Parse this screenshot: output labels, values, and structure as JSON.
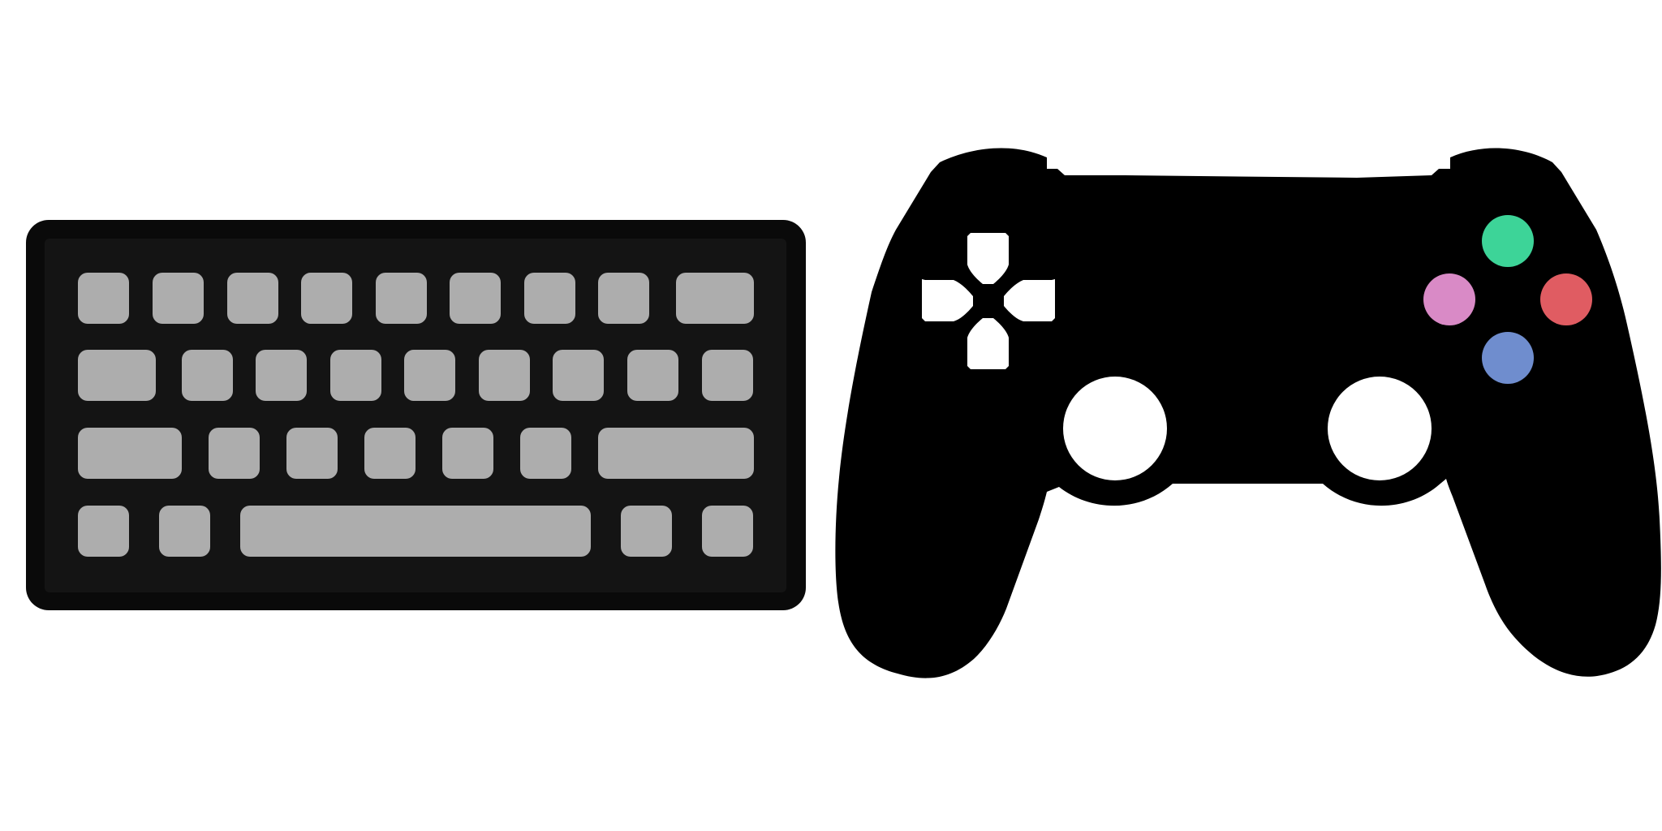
{
  "scene": {
    "background_color": "#ffffff"
  },
  "keyboard": {
    "icon": "keyboard-icon",
    "body_color": "#0a0a0a",
    "deck_color": "#141414",
    "key_color": "#adadad",
    "rows": [
      {
        "keys": [
          "key",
          "key",
          "key",
          "key",
          "key",
          "key",
          "key",
          "key",
          "wide-key"
        ]
      },
      {
        "keys": [
          "wide-key",
          "key",
          "key",
          "key",
          "key",
          "key",
          "key",
          "key",
          "key"
        ]
      },
      {
        "keys": [
          "extra-wide-key",
          "key",
          "key",
          "key",
          "key",
          "key",
          "enter-key"
        ]
      },
      {
        "keys": [
          "key",
          "key",
          "spacebar",
          "key",
          "key"
        ]
      }
    ]
  },
  "gamepad": {
    "icon": "gamepad-icon",
    "body_color": "#000000",
    "dpad": {
      "icon": "dpad-icon",
      "color": "#ffffff",
      "directions": [
        "up",
        "down",
        "left",
        "right"
      ]
    },
    "thumbsticks": [
      {
        "name": "left-thumbstick",
        "color": "#ffffff"
      },
      {
        "name": "right-thumbstick",
        "color": "#ffffff"
      }
    ],
    "face_buttons": [
      {
        "name": "top-button",
        "color": "#3dd498"
      },
      {
        "name": "left-button",
        "color": "#d98ac6"
      },
      {
        "name": "right-button",
        "color": "#e05c62"
      },
      {
        "name": "bottom-button",
        "color": "#6f8dce"
      }
    ]
  }
}
